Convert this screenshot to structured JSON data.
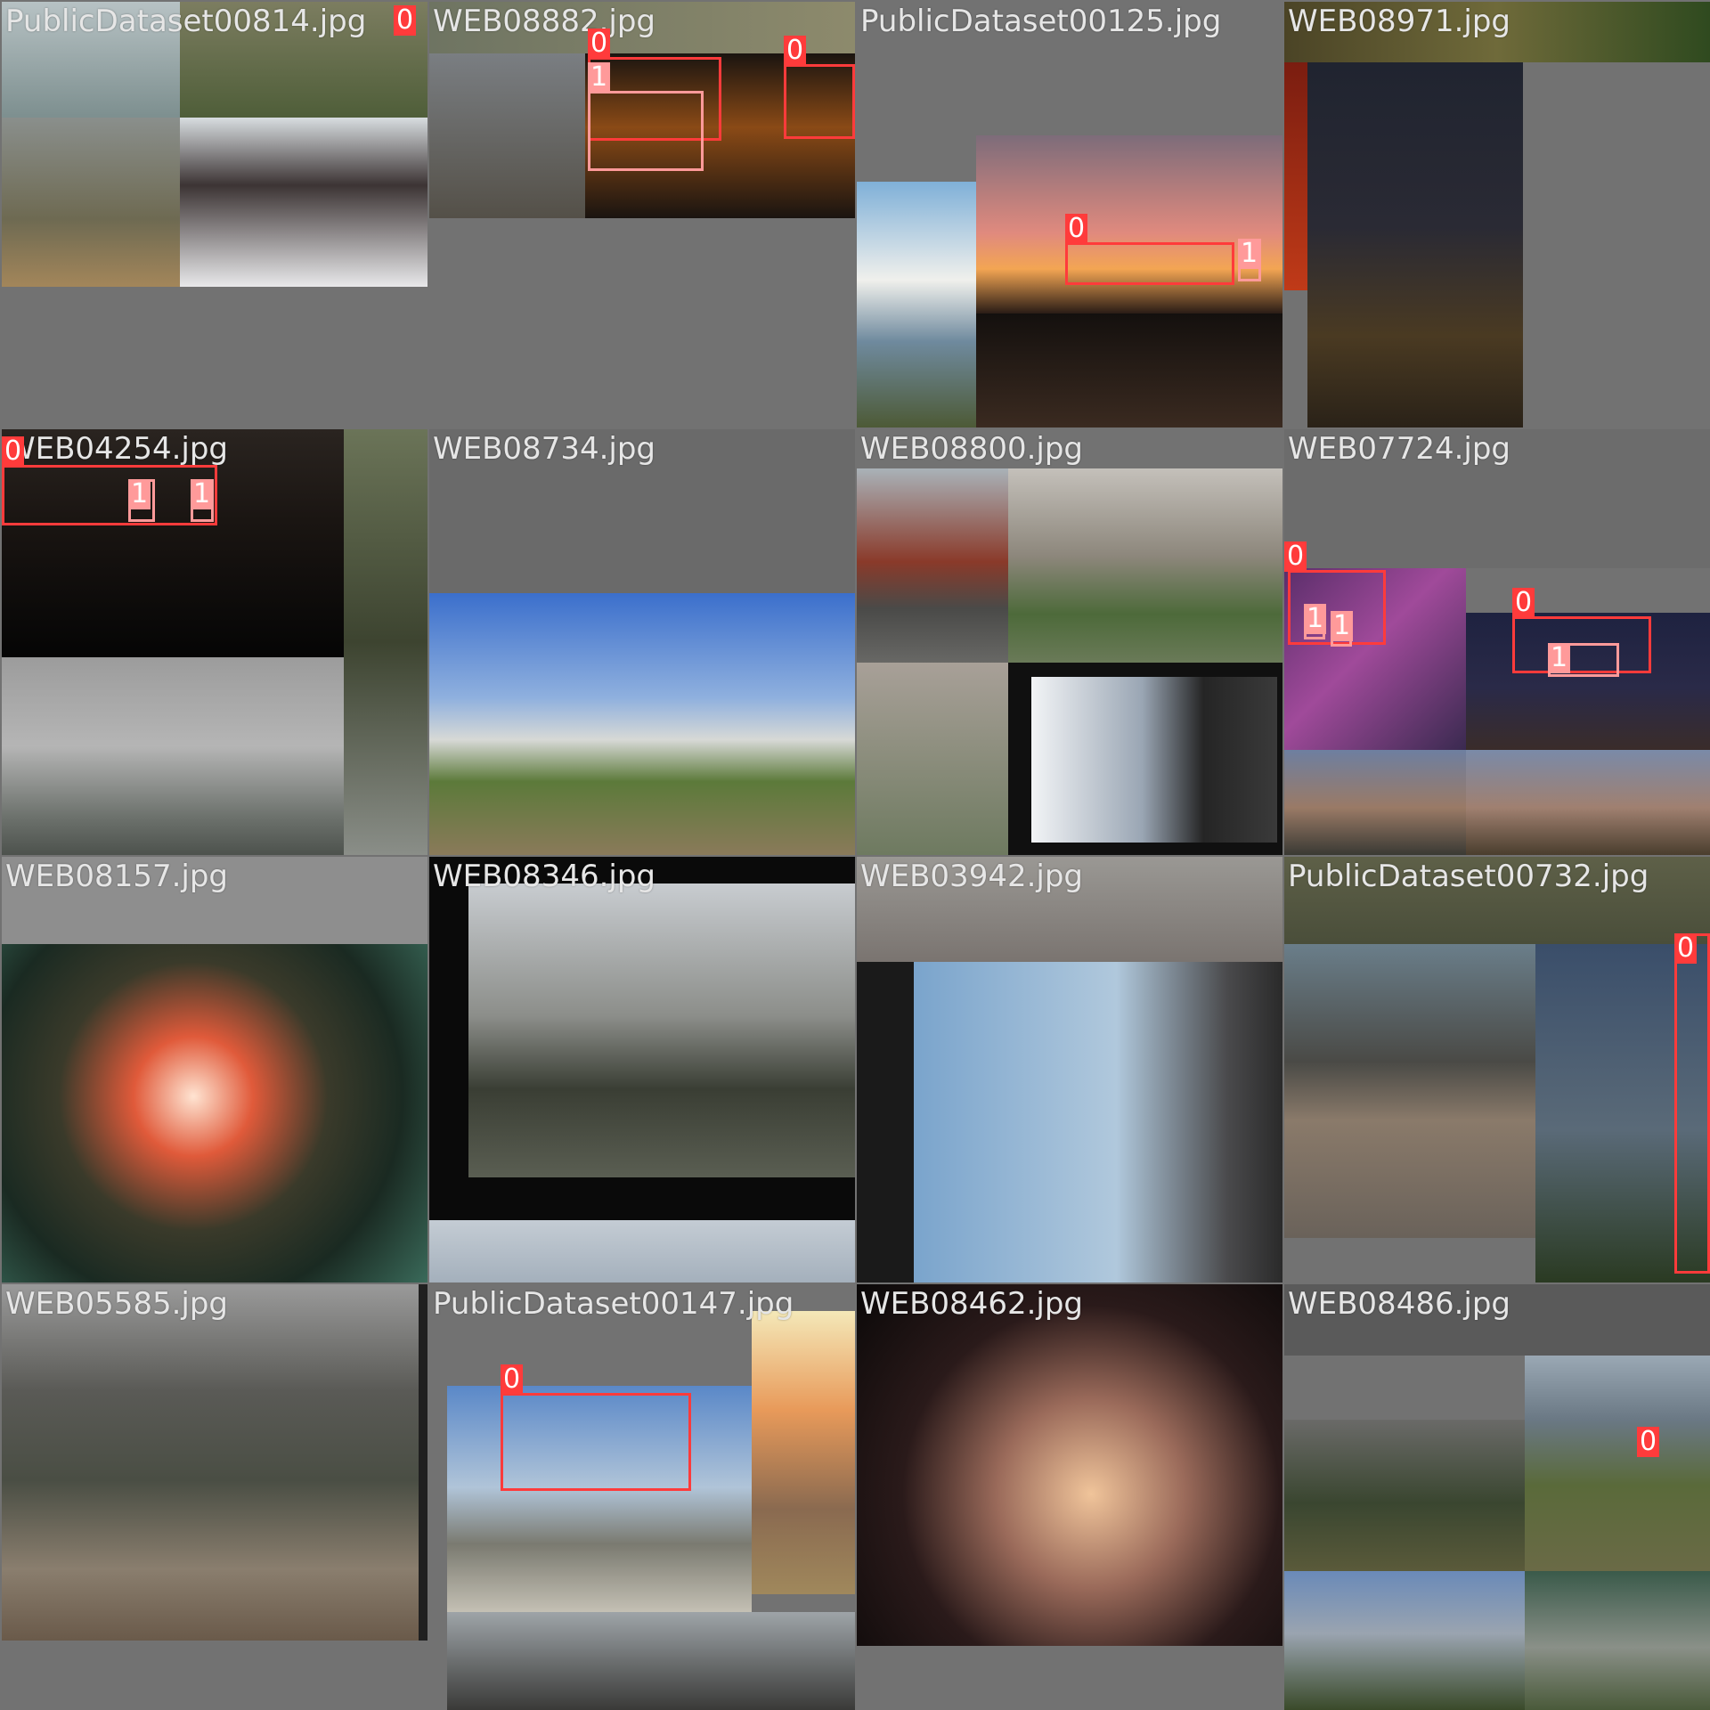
{
  "colors": {
    "background": "#727272",
    "class0": "#ff3b3b",
    "class1": "#ff9a9a"
  },
  "tiles": [
    {
      "filename": "PublicDataset00814.jpg"
    },
    {
      "filename": "WEB08882.jpg"
    },
    {
      "filename": "PublicDataset00125.jpg"
    },
    {
      "filename": "WEB08971.jpg"
    },
    {
      "filename": "WEB04254.jpg"
    },
    {
      "filename": "WEB08734.jpg"
    },
    {
      "filename": "WEB08800.jpg"
    },
    {
      "filename": "WEB07724.jpg"
    },
    {
      "filename": "WEB08157.jpg"
    },
    {
      "filename": "WEB08346.jpg"
    },
    {
      "filename": "WEB03942.jpg"
    },
    {
      "filename": "PublicDataset00732.jpg"
    },
    {
      "filename": "WEB05585.jpg"
    },
    {
      "filename": "PublicDataset00147.jpg"
    },
    {
      "filename": "WEB08462.jpg"
    },
    {
      "filename": "WEB08486.jpg"
    }
  ],
  "annotation_labels": {
    "class0": "0",
    "class1": "1"
  }
}
